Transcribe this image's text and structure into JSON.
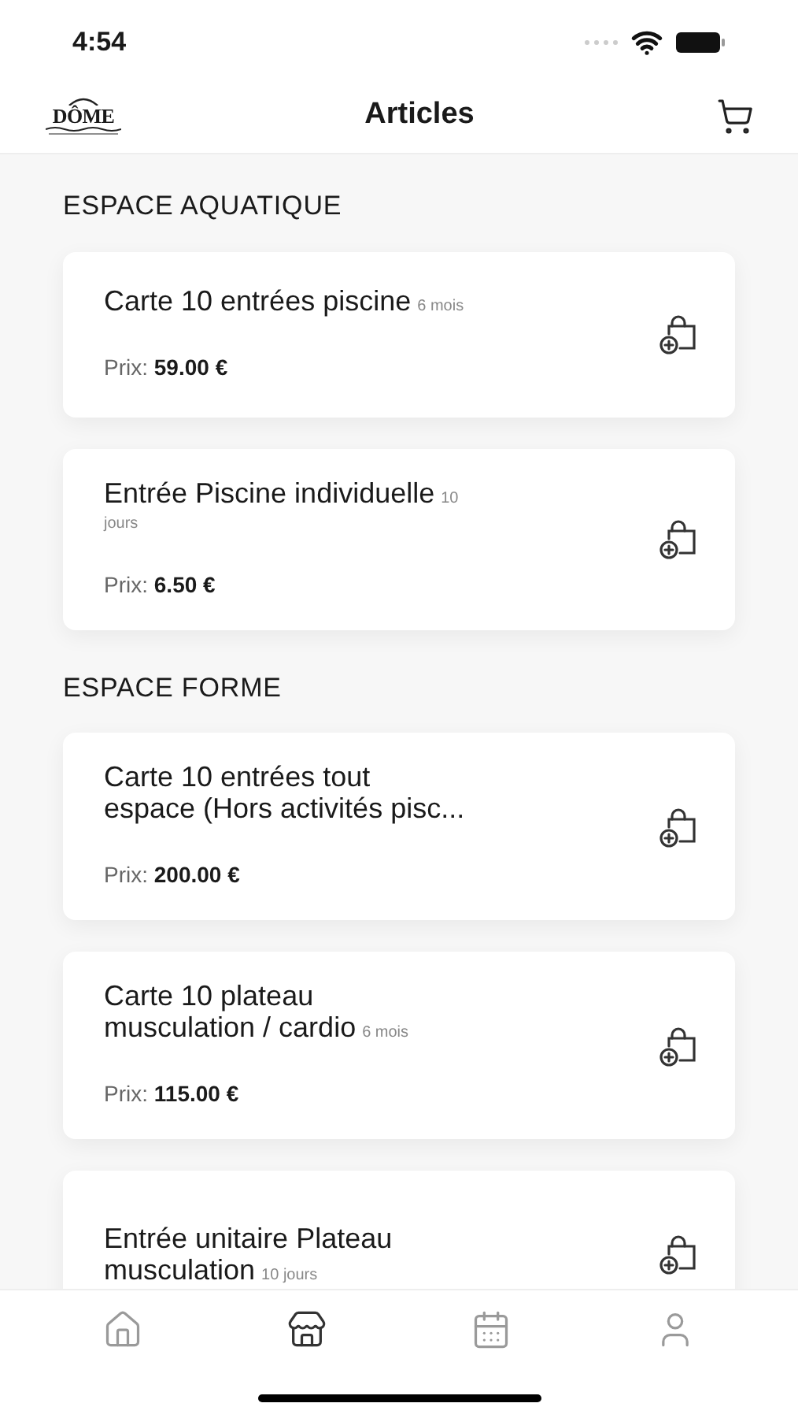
{
  "status_bar": {
    "time": "4:54"
  },
  "header": {
    "logo": "DÔME",
    "title": "Articles"
  },
  "sections": [
    {
      "title": "ESPACE AQUATIQUE",
      "items": [
        {
          "name": "Carte 10 entrées piscine",
          "duration": "6 mois",
          "price_label": "Prix:",
          "price": "59.00 €"
        },
        {
          "name": "Entrée Piscine individuelle",
          "duration": "10 jours",
          "price_label": "Prix:",
          "price": "6.50 €"
        }
      ]
    },
    {
      "title": "ESPACE FORME",
      "items": [
        {
          "name": "Carte 10 entrées tout espace (Hors activités pisc...",
          "price_label": "Prix:",
          "price": "200.00 €"
        },
        {
          "name": "Carte 10 plateau musculation / cardio",
          "duration": "6 mois",
          "price_label": "Prix:",
          "price": "115.00 €"
        },
        {
          "name": "Entrée unitaire Plateau musculation",
          "duration": "10 jours"
        }
      ]
    }
  ],
  "tabs": [
    {
      "kind": "home",
      "selected": false
    },
    {
      "kind": "shop",
      "selected": true
    },
    {
      "kind": "calendar",
      "selected": false
    },
    {
      "kind": "profile",
      "selected": false
    }
  ]
}
